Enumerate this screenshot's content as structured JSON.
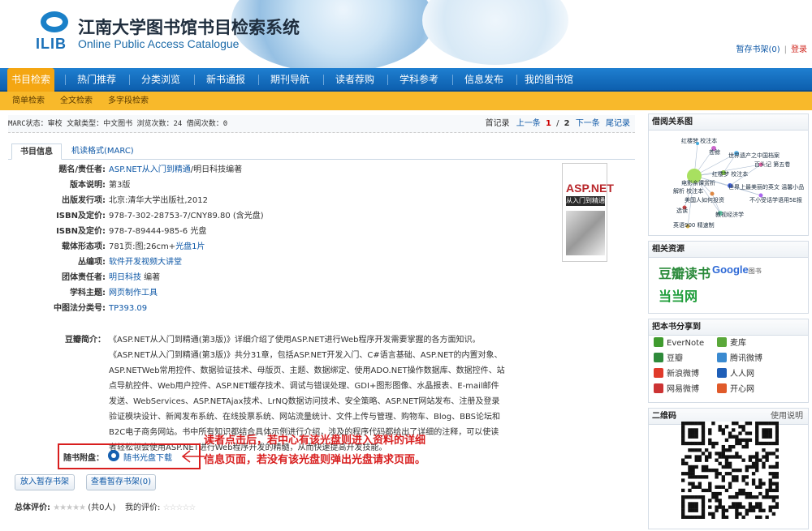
{
  "header": {
    "logo_text": "ILIB",
    "title": "江南大学图书馆书目检索系统",
    "subtitle": "Online Public Access Catalogue",
    "shelf_link": "暂存书架(0)",
    "separator": "|",
    "login": "登录"
  },
  "nav": {
    "items": [
      "书目检索",
      "热门推荐",
      "分类浏览",
      "新书通报",
      "期刊导航",
      "读者荐购",
      "学科参考",
      "信息发布",
      "我的图书馆"
    ]
  },
  "subnav": {
    "items": [
      "简单检索",
      "全文检索",
      "多字段检索"
    ]
  },
  "infobar": {
    "status": "MARC状态：审校   文献类型：中文图书   浏览次数：24   借阅次数：0",
    "first": "首记录",
    "prev": "上一条",
    "current": "1",
    "slash": "/",
    "total": "2",
    "next": "下一条",
    "last": "尾记录"
  },
  "tabs": {
    "book_info": "书目信息",
    "marc": "机读格式(MARC)"
  },
  "record": {
    "title_label": "题名/责任者:",
    "title_link": "ASP.NET从入门到精通",
    "title_rest": "/明日科技编著",
    "edition_label": "版本说明:",
    "edition": "第3版",
    "publish_label": "出版发行项:",
    "publish": "北京:清华大学出版社,2012",
    "isbn1_label": "ISBN及定价:",
    "isbn1": "978-7-302-28753-7/CNY89.80 (含光盘)",
    "isbn2_label": "ISBN及定价:",
    "isbn2": "978-7-89444-985-6 光盘",
    "carrier_label": "载体形态项:",
    "carrier_pre": "781页:图;26cm+",
    "carrier_link": "光盘1片",
    "series_label": "丛编项:",
    "series": "软件开发视频大讲堂",
    "corp_label": "团体责任者:",
    "corp_link": "明日科技",
    "corp_rest": " 编著",
    "subject_label": "学科主题:",
    "subject": "网页制作工具",
    "clc_label": "中图法分类号:",
    "clc": "TP393.09"
  },
  "cover": {
    "title": "ASP.NET",
    "subtitle": "从入门到精通"
  },
  "summary": {
    "label": "豆瓣简介：",
    "text": "《ASP.NET从入门到精通(第3版)》详细介绍了使用ASP.NET进行Web程序开发需要掌握的各方面知识。《ASP.NET从入门到精通(第3版)》共分31章，包括ASP.NET开发入门、C#语言基础、ASP.NET的内置对象、ASP.NETWeb常用控件、数据验证技术、母版页、主题、数据绑定、使用ADO.NET操作数据库、数据控件、站点导航控件、Web用户控件、ASP.NET缓存技术、调试与错误处理、GDI+图形图像、水晶报表、E-mail邮件发送、WebServices、ASP.NETAjax技术、LrNQ数据访问技术、安全策略、ASP.NET网站发布、注册及登录验证模块设计、新闻发布系统、在线投票系统、网站流量统计、文件上传与管理、购物车、Blog、BBS论坛和B2C电子商务网站。书中所有知识都结合具体示例进行介绍，涉及的程序代码都给出了详细的注释，可以使读者轻松领会使用ASP.NET进行Web程序开发的精髓，从而快速提高开发技能。"
  },
  "disc": {
    "label": "随书附盘：",
    "link": "随书光盘下载"
  },
  "annotation": {
    "line1": "读者点击后，若中心有该光盘则进入资料的详细",
    "line2": "信息页面，若没有该光盘则弹出光盘请求页面。"
  },
  "buttons": {
    "add_shelf": "放入暂存书架",
    "view_shelf": "查看暂存书架(0)"
  },
  "rating": {
    "total_label": "总体评价:",
    "total_count": "(共0人)",
    "my_label": "我的评价:"
  },
  "sidebar": {
    "borrow_title": "借阅关系图",
    "network_labels": [
      "红楼梦 校注本",
      "苍鲸",
      "世界遗产之中国档案",
      "百头记 第五卷",
      "红楼梦 校注本",
      "电影亲谭赏析",
      "世界上最美丽的英文 温馨小品",
      "解析 校注本",
      "美国人如何投资",
      "不小受话学语用5E报",
      "选读",
      "教视经济学",
      "英语900 精速制"
    ],
    "resources_title": "相关资源",
    "res_douban": "豆瓣读书",
    "res_google": "Google",
    "res_google_suffix": "图书",
    "res_dangdang": "当当网",
    "share_title": "把本书分享到",
    "share_items": [
      "EverNote",
      "麦库",
      "豆瓣",
      "腾讯微博",
      "新浪微博",
      "人人网",
      "网易微博",
      "开心网"
    ],
    "qr_title": "二维码",
    "qr_help": "使用说明"
  },
  "colors": {
    "nav_blue": "#0d5fae",
    "nav_active": "#f4a612",
    "subnav": "#f8b92b",
    "link": "#0d57a6",
    "annotation_red": "#d81e1e"
  }
}
